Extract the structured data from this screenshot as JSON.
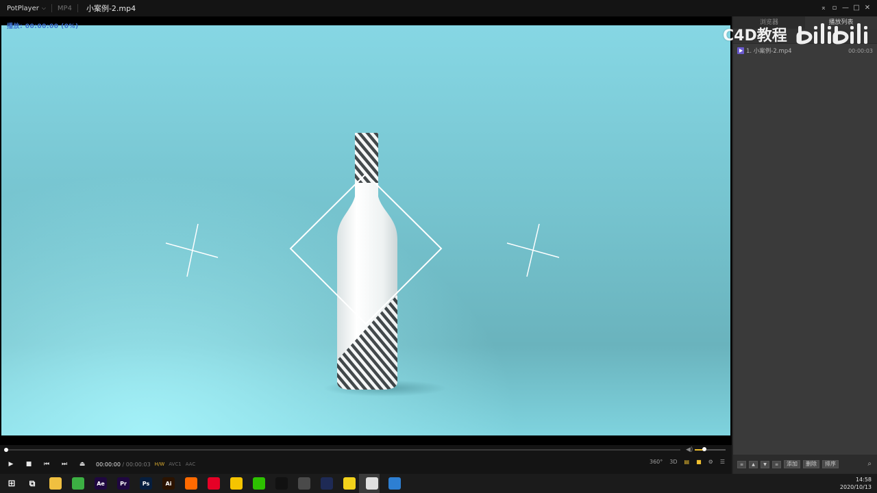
{
  "titlebar": {
    "app_name": "PotPlayer",
    "format": "MP4",
    "file_title": "小案例-2.mp4",
    "controls": [
      "⌅",
      "▫",
      "—",
      "□",
      "✕"
    ]
  },
  "osd": {
    "text": "播放: 00:00:00 (0%)"
  },
  "watermark": {
    "text": "C4D教程",
    "logo": "bilibili"
  },
  "panel": {
    "tabs": [
      "浏览器",
      "播放列表"
    ],
    "active_tab": 1,
    "items": [
      {
        "label": "1. 小案例-2.mp4",
        "duration": "00:00:03",
        "icon": "video-file-icon"
      }
    ],
    "bottom_buttons": [
      "≡",
      "▲",
      "▼",
      "≡"
    ],
    "bottom_text_buttons": [
      "添加",
      "删除",
      "排序"
    ],
    "search_icon": "search-icon"
  },
  "playback": {
    "progress": 0.0,
    "volume": 0.3,
    "current_time": "00:00:00",
    "total_time": "00:00:03",
    "tags": {
      "hw": "H/W",
      "video": "AVC1",
      "audio": "AAC"
    },
    "right_labels": {
      "vr": "360°",
      "three_d": "3D"
    }
  },
  "taskbar": {
    "time": "14:58",
    "date": "2020/10/13",
    "apps": [
      {
        "name": "file-explorer-icon",
        "label": "",
        "color": "#f0c040"
      },
      {
        "name": "green-app-icon",
        "label": "",
        "color": "#3cb043"
      },
      {
        "name": "after-effects-icon",
        "label": "Ae",
        "color": "#1f0740"
      },
      {
        "name": "premiere-icon",
        "label": "Pr",
        "color": "#1f0740"
      },
      {
        "name": "photoshop-icon",
        "label": "Ps",
        "color": "#061e3e"
      },
      {
        "name": "illustrator-icon",
        "label": "Ai",
        "color": "#2b1300"
      },
      {
        "name": "search-app-icon",
        "label": "",
        "color": "#ff6a00"
      },
      {
        "name": "netease-music-icon",
        "label": "",
        "color": "#e60026"
      },
      {
        "name": "yellow-app-icon",
        "label": "",
        "color": "#f5c400"
      },
      {
        "name": "wechat-icon",
        "label": "",
        "color": "#2dc100"
      },
      {
        "name": "qq-icon",
        "label": "",
        "color": "#111111"
      },
      {
        "name": "calculator-icon",
        "label": "",
        "color": "#4a4a4a"
      },
      {
        "name": "cinema4d-icon",
        "label": "",
        "color": "#1e2a55"
      },
      {
        "name": "notes-app-icon",
        "label": "",
        "color": "#f2d21b"
      },
      {
        "name": "potplayer-icon",
        "label": "",
        "color": "#e0e0e0"
      },
      {
        "name": "photos-icon",
        "label": "",
        "color": "#2d7fd3"
      }
    ]
  }
}
